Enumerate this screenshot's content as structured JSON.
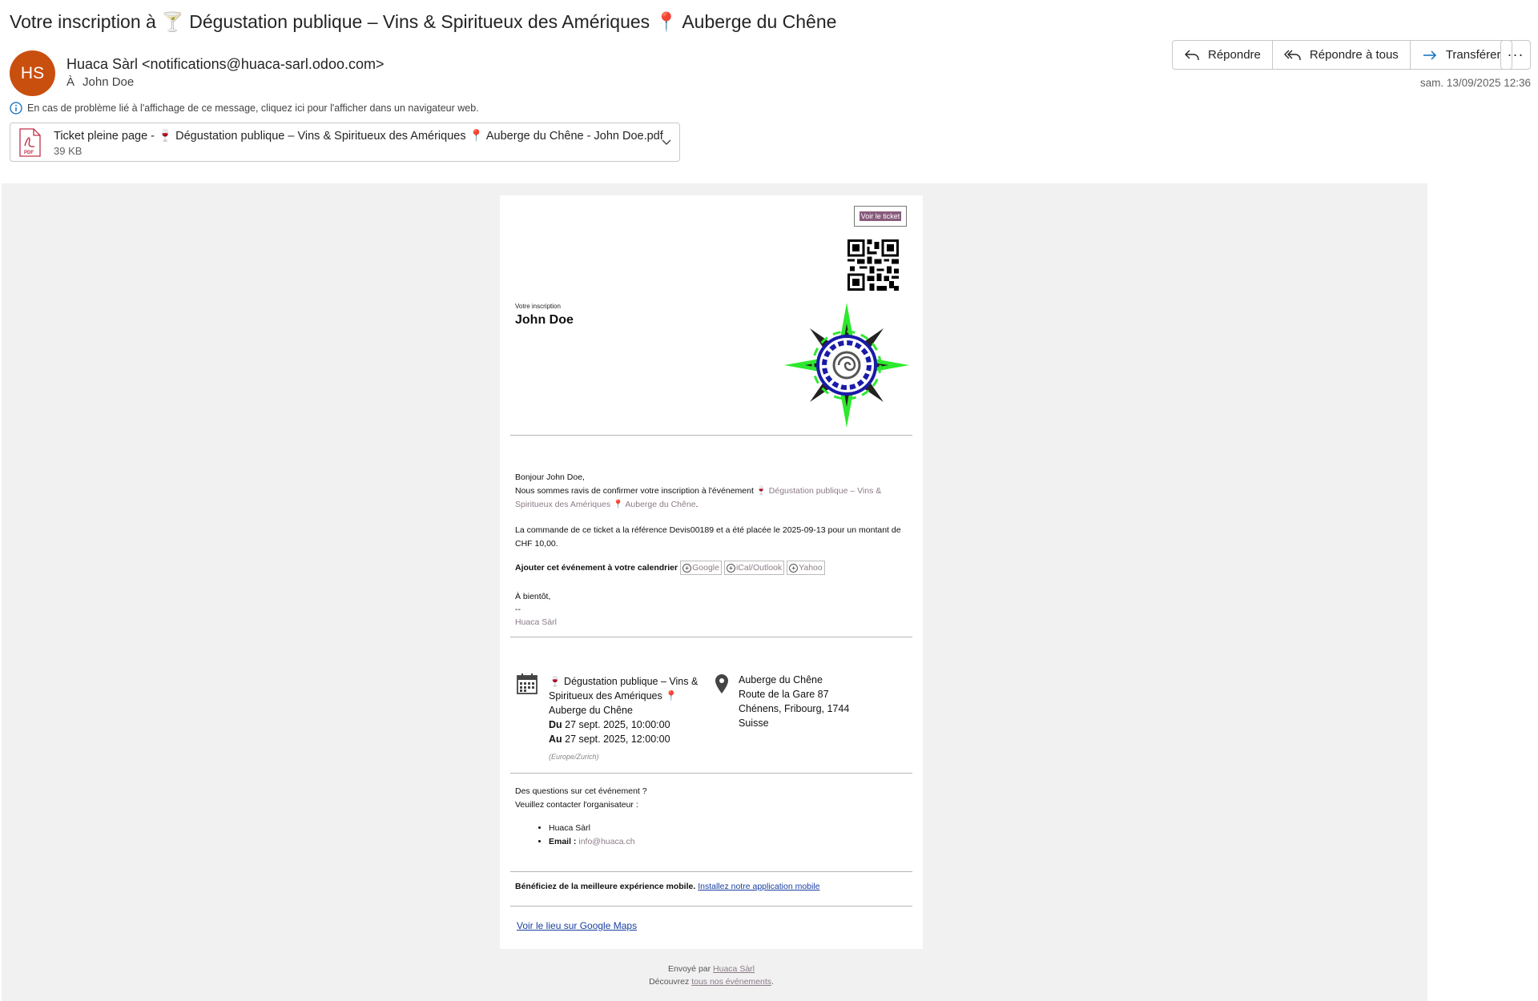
{
  "email": {
    "subject": "Votre inscription à 🍸 Dégustation publique – Vins & Spiritueux des Amériques 📍 Auberge du Chêne",
    "avatar_initials": "HS",
    "avatar_color": "#c94f0f",
    "from": "Huaca Sàrl <notifications@huaca-sarl.odoo.com>",
    "to_label": "À",
    "to": "John Doe",
    "info_banner": "En cas de problème lié à l'affichage de ce message, cliquez ici pour l'afficher dans un navigateur web.",
    "date": "sam. 13/09/2025 12:36",
    "actions": {
      "reply": "Répondre",
      "reply_all": "Répondre à tous",
      "forward": "Transférer",
      "more": "···"
    },
    "attachment": {
      "name": "Ticket pleine page - 🍷 Dégustation publique – Vins & Spiritueux des Amériques 📍 Auberge du Chêne - John Doe.pdf",
      "size": "39 KB",
      "icon": "pdf-icon"
    }
  },
  "ticket": {
    "view_ticket": "Voir le ticket",
    "registration_label": "Votre inscription",
    "attendee_name": "John Doe",
    "greeting": "Bonjour John Doe,",
    "confirm_text": "Nous sommes ravis de confirmer votre inscription à l'événement",
    "event_link": "🍷 Dégustation publique – Vins & Spiritueux des Amériques 📍 Auberge du Chêne",
    "order_text": "La commande de ce ticket a la référence Devis00189 et a été placée le 2025-09-13 pour un montant de CHF 10,00.",
    "calendar_label": "Ajouter cet événement à votre calendrier",
    "calendar_buttons": {
      "google": "Google",
      "ical": "iCal/Outlook",
      "yahoo": "Yahoo"
    },
    "closing": "À bientôt,",
    "dashes": "--",
    "signature": "Huaca Sàrl",
    "event_name": "🍷 Dégustation publique – Vins & Spiritueux des Amériques 📍 Auberge du Chêne",
    "from_label": "Du",
    "from_date": "27 sept. 2025, 10:00:00",
    "to_label": "Au",
    "to_date": "27 sept. 2025, 12:00:00",
    "timezone": "(Europe/Zurich)",
    "address": {
      "line1": "Auberge du Chêne",
      "line2": "Route de la Gare 87",
      "line3": "Chénens, Fribourg, 1744",
      "line4": "Suisse"
    },
    "questions": "Des questions sur cet événement ?",
    "contact_label": "Veuillez contacter l'organisateur :",
    "organizer": "Huaca Sàrl",
    "email_label": "Email :",
    "email": "info@huaca.ch",
    "mobile_bold": "Bénéficiez de la meilleure expérience mobile.",
    "mobile_link": "Installez notre application mobile",
    "maps_link": "Voir le lieu sur Google Maps"
  },
  "footer": {
    "sent_by": "Envoyé par",
    "sender": "Huaca Sàrl",
    "discover": "Découvrez",
    "events_link": "tous nos événements"
  }
}
